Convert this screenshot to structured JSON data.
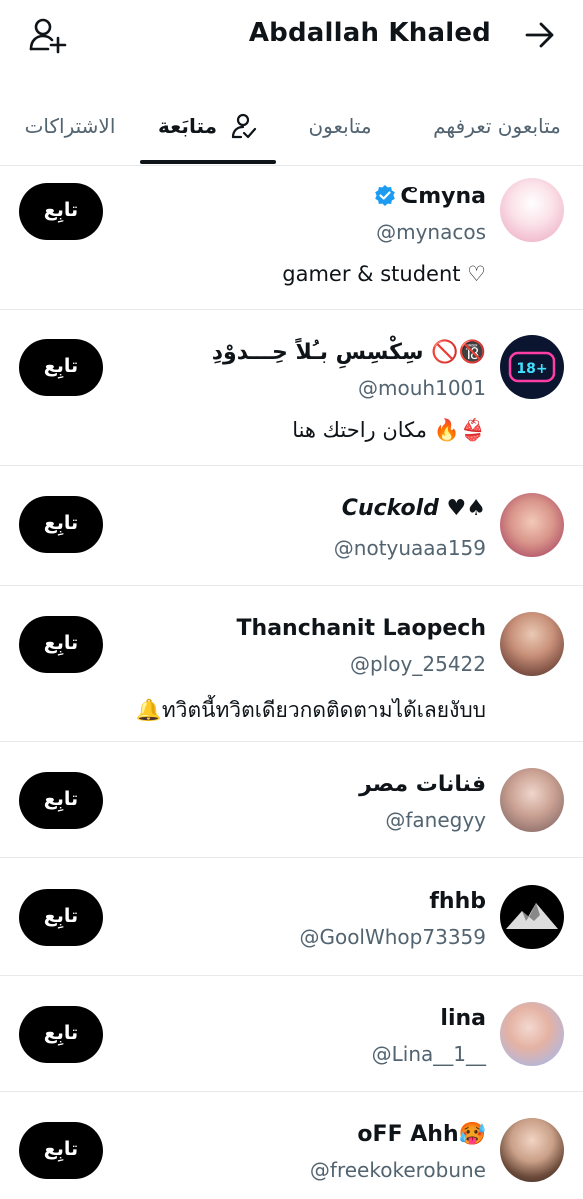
{
  "header": {
    "title": "Abdallah Khaled",
    "add_icon": "add-user-icon",
    "back_icon": "arrow-right-icon"
  },
  "tabs": [
    {
      "label": "الاشتراكات",
      "active": false
    },
    {
      "label": "متابَعة",
      "active": true,
      "icon": "user-check-icon"
    },
    {
      "label": "متابعون",
      "active": false
    },
    {
      "label": "متابعون تعرفهم",
      "active": false
    }
  ],
  "accounts": [
    {
      "name": "ᕦmyna",
      "verified": true,
      "handle": "@mynacos",
      "bio": "gamer & student ♡",
      "button": "تابِع"
    },
    {
      "name": "سِكْسِسِ بـُلاً حِـــدوْدِ 🚫🔞",
      "verified": false,
      "handle": "@mouh1001",
      "bio": "مكان راحتك هنا 🔥👙",
      "button": "تابِع"
    },
    {
      "name": "Cuckold ♥♠",
      "verified": false,
      "handle": "@notyuaaa159",
      "bio": "",
      "button": "تابِع"
    },
    {
      "name": "Thanchanit Laopech",
      "verified": false,
      "handle": "@ploy_25422",
      "bio": "🔔ทวิตนี้ทวิตเดียวกดติดตามได้เลยงับบ",
      "button": "تابِع"
    },
    {
      "name": "فنانات مصر",
      "verified": false,
      "handle": "@fanegyy",
      "bio": "",
      "button": "تابِع"
    },
    {
      "name": "fhhb",
      "verified": false,
      "handle": "@GoolWhop73359",
      "bio": "",
      "button": "تابِع"
    },
    {
      "name": "lina",
      "verified": false,
      "handle": "@Lina__1__",
      "bio": "",
      "button": "تابِع"
    },
    {
      "name": "oFF Ahh🥵",
      "verified": false,
      "handle": "@freekokerobune",
      "bio": "",
      "button": "تابِع"
    }
  ],
  "colors": {
    "text": "#0f1419",
    "secondary": "#536471",
    "verified": "#1d9bf0",
    "button_bg": "#000000",
    "divider": "#e6e9ec"
  }
}
